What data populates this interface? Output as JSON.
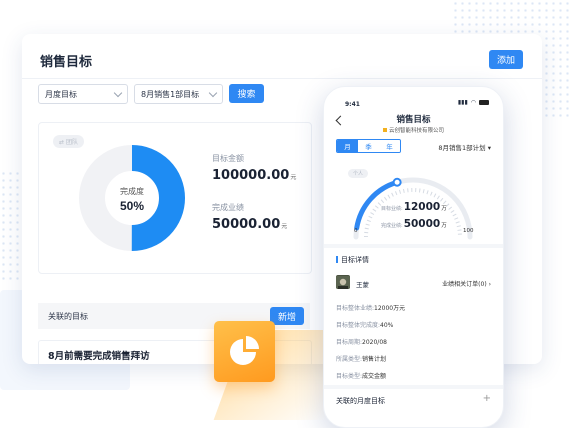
{
  "colors": {
    "accent": "#2f88f3",
    "icon_orange": "#ffa62b"
  },
  "card": {
    "title": "销售目标",
    "add_label": "添加",
    "filter_period": "月度目标",
    "filter_target": "8月销售1部目标",
    "search_label": "搜索",
    "tag": "团队",
    "donut": {
      "label": "完成度",
      "percent_text": "50%",
      "completion": 0.5
    },
    "target_label": "目标金额",
    "target_value": "100000.00",
    "target_unit": "元",
    "done_label": "完成业绩",
    "done_value": "50000.00",
    "done_unit": "元",
    "assoc_title": "关联的目标",
    "assoc_add": "新增",
    "task_text": "8月前需要完成销售拜访"
  },
  "app_icon": "pie-chart-icon",
  "phone": {
    "time": "9:41",
    "title": "销售目标",
    "company": "云创智能科技有限公司",
    "tabs": [
      {
        "label": "月",
        "active": true
      },
      {
        "label": "季",
        "active": false
      },
      {
        "label": "年",
        "active": false
      }
    ],
    "plan_select": "8月销售1部计划",
    "gauge_tag": "个人",
    "gauge_target_label": "目标业绩:",
    "gauge_target_value": "12000",
    "gauge_target_unit": "万",
    "gauge_done_label": "完成业绩:",
    "gauge_done_value": "50000",
    "gauge_done_unit": "万",
    "gauge_min": "0",
    "gauge_max": "100",
    "detail_title": "目标详情",
    "person_name": "王蒙",
    "person_link": "业绩相关订单(0)",
    "rows": [
      {
        "key": "目标整体业绩:",
        "value": "12000万元"
      },
      {
        "key": "目标整体完成度:",
        "value": "40%"
      },
      {
        "key": "目标周期:",
        "value": "2020/08"
      },
      {
        "key": "所属类型:",
        "value": "销售计划"
      },
      {
        "key": "目标类型:",
        "value": "成交金额"
      }
    ],
    "monthly_title": "关联的月度目标"
  }
}
